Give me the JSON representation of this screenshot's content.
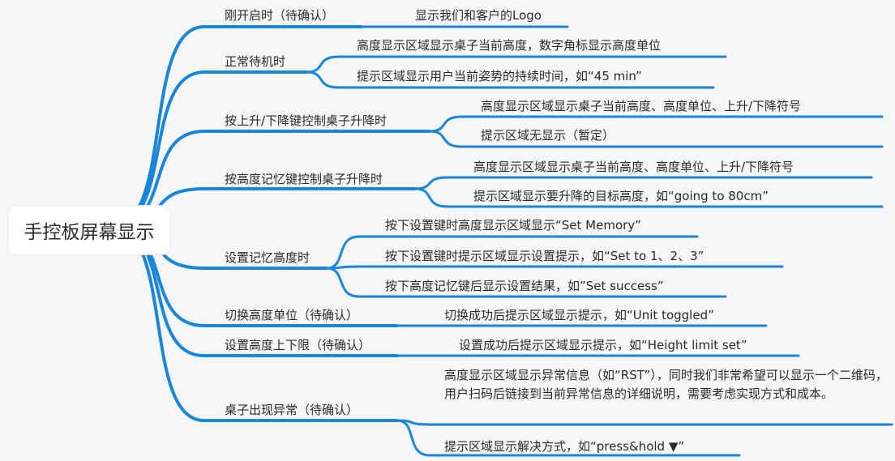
{
  "root": {
    "label": "手控板屏幕显示"
  },
  "branches": [
    {
      "id": "b1",
      "label": "刚开启时（待确认）",
      "leaves": [
        {
          "label": "显示我们和客户的Logo"
        }
      ]
    },
    {
      "id": "b2",
      "label": "正常待机时",
      "leaves": [
        {
          "label": "高度显示区域显示桌子当前高度，数字角标显示高度单位"
        },
        {
          "label": "提示区域显示用户当前姿势的持续时间，如“45 min”"
        }
      ]
    },
    {
      "id": "b3",
      "label": "按上升/下降键控制桌子升降时",
      "leaves": [
        {
          "label": "高度显示区域显示桌子当前高度、高度单位、上升/下降符号"
        },
        {
          "label": "提示区域无显示（暂定）"
        }
      ]
    },
    {
      "id": "b4",
      "label": "按高度记忆键控制桌子升降时",
      "leaves": [
        {
          "label": "高度显示区域显示桌子当前高度、高度单位、上升/下降符号"
        },
        {
          "label": "提示区域显示要升降的目标高度，如“going to 80cm”"
        }
      ]
    },
    {
      "id": "b5",
      "label": "设置记忆高度时",
      "leaves": [
        {
          "label": "按下设置键时高度显示区域显示“Set Memory”"
        },
        {
          "label": "按下设置键时提示区域显示设置提示，如“Set to 1、2、3”"
        },
        {
          "label": "按下高度记忆键后显示设置结果，如”Set success”"
        }
      ]
    },
    {
      "id": "b6",
      "label": "切换高度单位（待确认）",
      "leaves": [
        {
          "label": "切换成功后提示区域显示提示，如“Unit toggled”"
        }
      ]
    },
    {
      "id": "b7",
      "label": "设置高度上下限（待确认）",
      "leaves": [
        {
          "label": "设置成功后提示区域显示提示，如“Height limit set”"
        }
      ]
    },
    {
      "id": "b8",
      "label": "桌子出现异常（待确认）",
      "leaves": [
        {
          "label": "高度显示区域显示异常信息（如“RST”），同时我们非常希望可以显示一个二维码，用户扫码后链接到当前异常信息的详细说明，需要考虑实现方式和成本。"
        },
        {
          "label": "提示区域显示解决方式，如“press&hold ▼”"
        }
      ]
    }
  ],
  "colors": {
    "line": "#1a86d9",
    "background": "#f5f6f8",
    "text": "#2a2a2a"
  }
}
